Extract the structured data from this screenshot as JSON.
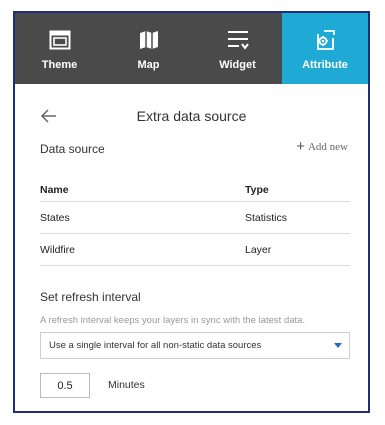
{
  "tabs": [
    {
      "label": "Theme",
      "icon": "theme-icon",
      "active": false
    },
    {
      "label": "Map",
      "icon": "map-icon",
      "active": false
    },
    {
      "label": "Widget",
      "icon": "widget-icon",
      "active": false
    },
    {
      "label": "Attribute",
      "icon": "attribute-icon",
      "active": true
    }
  ],
  "header": {
    "title": "Extra data source",
    "back_icon": "arrow-left-icon"
  },
  "data_source": {
    "label": "Data source",
    "add_new_label": "Add new",
    "columns": {
      "name": "Name",
      "type": "Type"
    },
    "rows": [
      {
        "name": "States",
        "type": "Statistics"
      },
      {
        "name": "Wildfire",
        "type": "Layer"
      }
    ]
  },
  "refresh": {
    "label": "Set refresh interval",
    "hint": "A refresh interval keeps your layers in sync with the latest data.",
    "selected_option": "Use a single interval for all non-static data sources",
    "interval_value": "0.5",
    "unit_label": "Minutes"
  },
  "colors": {
    "tab_bar": "#4a4a4a",
    "active_tab": "#1fa9d5",
    "border": "#1f2f7a",
    "caret": "#1f6fbf"
  }
}
